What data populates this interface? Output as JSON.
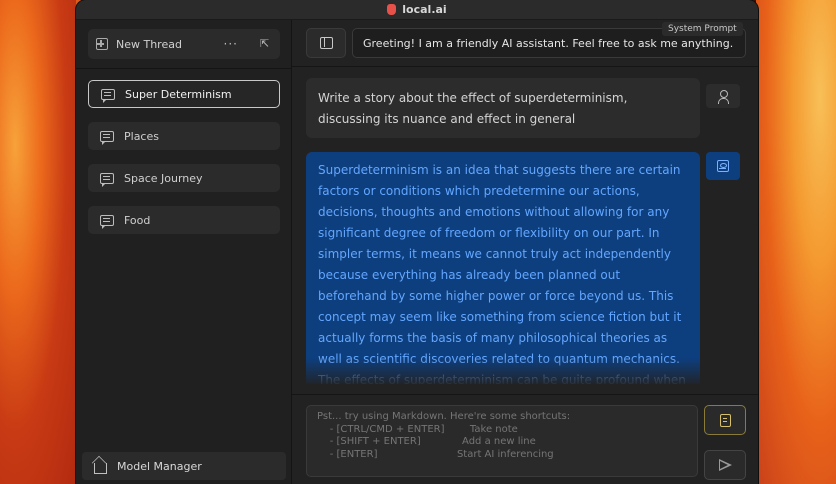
{
  "app": {
    "title": "local.ai"
  },
  "sidebar": {
    "new_thread_label": "New Thread",
    "more_label": "···",
    "threads": [
      {
        "label": "Super Determinism",
        "active": true
      },
      {
        "label": "Places",
        "active": false
      },
      {
        "label": "Space Journey",
        "active": false
      },
      {
        "label": "Food",
        "active": false
      }
    ],
    "model_manager_label": "Model Manager"
  },
  "main": {
    "system_prompt_label": "System Prompt",
    "system_prompt_value": "Greeting! I am a friendly AI assistant. Feel free to ask me anything.",
    "user_message": "Write a story about the effect of superdeterminism, discussing its nuance and effect in general",
    "ai_message": "Superdeterminism is an idea that suggests there are certain factors or conditions which predetermine our actions, decisions, thoughts and emotions without allowing for any significant degree of freedom or flexibility on our part. In simpler terms, it means we cannot truly act independently because everything has already been planned out beforehand by some higher power or force beyond us. This concept may seem like something from science fiction but it actually forms the basis of many philosophical theories as well as scientific discoveries related to quantum mechanics. The effects of superdeterminism can be quite profound when considered at both individual level",
    "input_placeholder": "Pst... try using Markdown. Here're some shortcuts:\n    - [CTRL/CMD + ENTER]        Take note\n    - [SHIFT + ENTER]             Add a new line\n    - [ENTER]                         Start AI inferencing"
  },
  "colors": {
    "ai_bubble": "#0d3f7e",
    "ai_text": "#63a6ff",
    "note_accent": "#d6c06a"
  }
}
